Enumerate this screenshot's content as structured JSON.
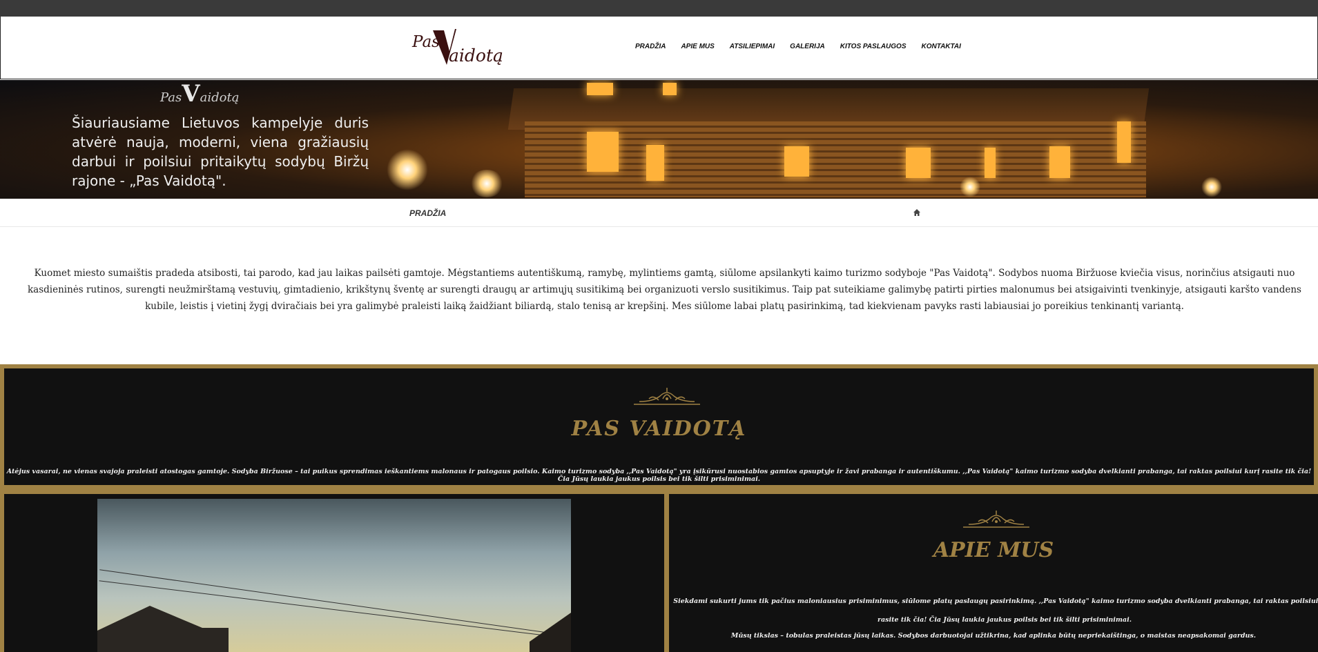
{
  "logo": {
    "part1": "Pas",
    "letter": "V",
    "part2": "aidotą"
  },
  "nav": [
    "PRADŽIA",
    "APIE MUS",
    "ATSILIEPIMAI",
    "GALERIJA",
    "KITOS PASLAUGOS",
    "KONTAKTAI"
  ],
  "hero": {
    "logo_part1": "Pas",
    "logo_letter": "V",
    "logo_part2": "aidotą",
    "slogan": "Šiauriausiame Lietuvos kampelyje duris atvėrė nauja, moderni, viena gražiausių darbui ir poilsiui pritaikytų sodybų Biržų rajone - „Pas Vaidotą\"."
  },
  "breadcrumb": {
    "label": "PRADŽIA",
    "home_icon": "home-icon"
  },
  "intro": "Kuomet miesto sumaištis pradeda atsibosti, tai parodo, kad jau laikas pailsėti gamtoje. Mėgstantiems autentiškumą, ramybę, mylintiems gamtą, siūlome apsilankyti kaimo turizmo sodyboje \"Pas Vaidotą\". Sodybos nuoma Biržuose kviečia visus, norinčius atsigauti nuo kasdieninės rutinos, surengti neužmirštamą vestuvių, gimtadienio, krikštynų šventę ar surengti draugų ar artimųjų susitikimą bei organizuoti verslo susitikimus. Taip pat suteikiame galimybę patirti pirties malonumus bei atsigaivinti tvenkinyje,  atsigauti karšto vandens kubile,  leistis į vietinį žygį dviračiais bei yra galimybė praleisti laiką žaidžiant biliardą, stalo tenisą ar krepšinį. Mes siūlome labai platų pasirinkimą, tad kiekvienam pavyks rasti labiausiai jo poreikius tenkinantį variantą.",
  "band": {
    "title": "PAS VAIDOTĄ",
    "text": "Atėjus vasarai, ne vienas svajoja praleisti atostogas gamtoje. Sodyba Biržuose – tai puikus sprendimas ieškantiems malonaus ir patogaus poilsio. Kaimo turizmo sodyba ,,Pas Vaidotą\" yra įsikūrusi nuostabios gamtos apsuptyje ir žavi prabanga ir autentiškumu. ,,Pas Vaidotą\" kaimo turizmo sodyba dvelkianti prabanga, tai raktas poilsiui kurį rasite tik čia! Čia Jūsų laukia jaukus poilsis bei tik šilti prisiminimai."
  },
  "about": {
    "title": "APIE MUS",
    "text1": "Siekdami sukurti jums tik pačius maloniausius prisiminimus, siūlome platų paslaugų pasirinkimą. ,,Pas Vaidotą\" kaimo turizmo sodyba dvelkianti prabanga, tai raktas poilsiui kurį rasite tik čia! Čia Jūsų laukia jaukus poilsis bei tik šilti prisiminimai.",
    "text2": "Mūsų tikslas – tobulas praleistas jūsų laikas. Sodybos darbuotojai užtikrina, kad aplinka būtų nepriekaištinga, o maistas neapsakomai gardus."
  },
  "colors": {
    "gold": "#a08244",
    "dark": "#111111",
    "logo": "#3a1010"
  }
}
